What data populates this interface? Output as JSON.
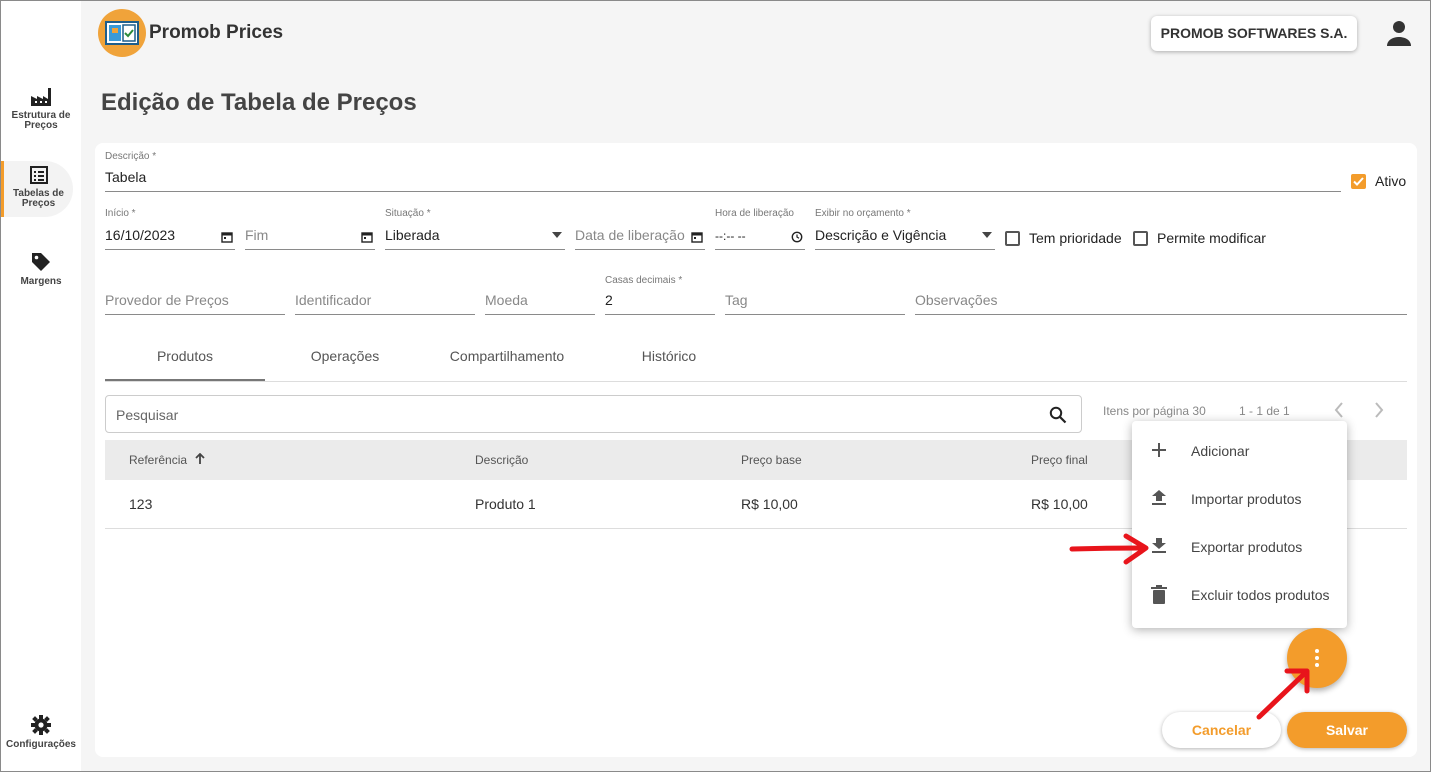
{
  "app": {
    "title": "Promob Prices",
    "company": "PROMOB SOFTWARES S.A."
  },
  "sidebar": {
    "items": [
      {
        "label": "Estrutura de Preços",
        "icon": "factory-icon"
      },
      {
        "label": "Tabelas de Preços",
        "icon": "list-icon",
        "active": true
      },
      {
        "label": "Margens",
        "icon": "tag-icon"
      },
      {
        "label": "Configurações",
        "icon": "gear-icon"
      }
    ]
  },
  "page": {
    "title": "Edição de Tabela de Preços"
  },
  "form": {
    "descricao": {
      "label": "Descrição *",
      "value": "Tabela"
    },
    "ativo": {
      "label": "Ativo",
      "checked": true
    },
    "inicio": {
      "label": "Início *",
      "value": "16/10/2023"
    },
    "fim": {
      "placeholder": "Fim"
    },
    "situacao": {
      "label": "Situação *",
      "value": "Liberada"
    },
    "data_liberacao": {
      "placeholder": "Data de liberação"
    },
    "hora_liberacao": {
      "label": "Hora de liberação",
      "value": "--:-- --"
    },
    "exibir": {
      "label": "Exibir no orçamento *",
      "value": "Descrição e Vigência"
    },
    "tem_prioridade": {
      "label": "Tem prioridade",
      "checked": false
    },
    "permite_modificar": {
      "label": "Permite modificar",
      "checked": false
    },
    "provedor": {
      "placeholder": "Provedor de Preços"
    },
    "identificador": {
      "placeholder": "Identificador"
    },
    "moeda": {
      "placeholder": "Moeda"
    },
    "casas_decimais": {
      "label": "Casas decimais *",
      "value": "2"
    },
    "tag": {
      "placeholder": "Tag"
    },
    "observacoes": {
      "placeholder": "Observações"
    }
  },
  "tabs": [
    {
      "label": "Produtos",
      "active": true
    },
    {
      "label": "Operações"
    },
    {
      "label": "Compartilhamento"
    },
    {
      "label": "Histórico"
    }
  ],
  "search": {
    "placeholder": "Pesquisar"
  },
  "pager": {
    "per_page_label": "Itens por página 30",
    "range": "1 - 1 de 1"
  },
  "table": {
    "headers": [
      "Referência",
      "Descrição",
      "Preço base",
      "Preço final"
    ],
    "rows": [
      [
        "123",
        "Produto 1",
        "R$ 10,00",
        "R$ 10,00"
      ]
    ]
  },
  "menu": {
    "items": [
      {
        "label": "Adicionar",
        "icon": "plus-icon"
      },
      {
        "label": "Importar produtos",
        "icon": "upload-icon"
      },
      {
        "label": "Exportar produtos",
        "icon": "download-icon"
      },
      {
        "label": "Excluir todos produtos",
        "icon": "trash-icon"
      }
    ]
  },
  "actions": {
    "cancel": "Cancelar",
    "save": "Salvar"
  },
  "colors": {
    "accent": "#f39c2b",
    "annotation": "#e8141b"
  }
}
